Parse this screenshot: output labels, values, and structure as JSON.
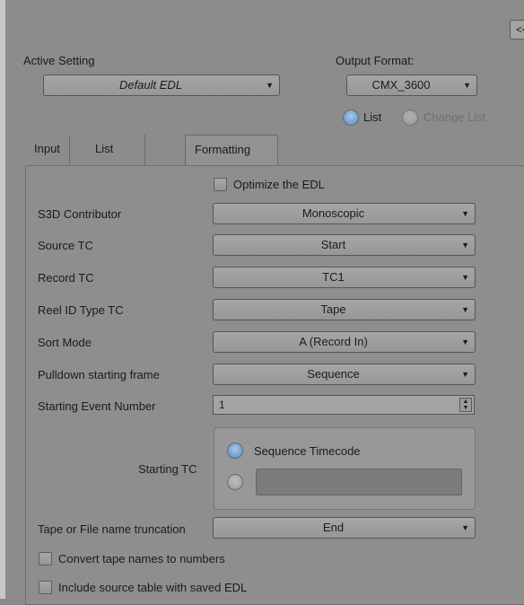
{
  "collapse_button": "<<",
  "active_setting": {
    "label": "Active Setting",
    "value": "Default EDL"
  },
  "output_format": {
    "label": "Output Format:",
    "value": "CMX_3600"
  },
  "list_mode": {
    "list_label": "List",
    "change_list_label": "Change List",
    "selected": "List"
  },
  "tabs": [
    {
      "label": "Input"
    },
    {
      "label": "List Options"
    },
    {
      "label": "Formatting",
      "active": true
    }
  ],
  "optimize": {
    "label": "Optimize the EDL",
    "checked": false
  },
  "rows": [
    {
      "label": "S3D Contributor",
      "value": "Monoscopic"
    },
    {
      "label": "Source TC",
      "value": "Start"
    },
    {
      "label": "Record TC",
      "value": "TC1"
    },
    {
      "label": "Reel ID Type TC",
      "value": "Tape"
    },
    {
      "label": "Sort Mode",
      "value": "A (Record In)"
    },
    {
      "label": "Pulldown starting frame",
      "value": "Sequence"
    }
  ],
  "starting_event": {
    "label": "Starting Event Number",
    "value": "1"
  },
  "starting_tc": {
    "label": "Starting TC",
    "option_sequence": "Sequence Timecode",
    "custom_value": "",
    "selected": "Sequence Timecode"
  },
  "truncation": {
    "label": "Tape or File name truncation",
    "value": "End"
  },
  "convert_tape": {
    "label": "Convert tape names to numbers",
    "checked": false
  },
  "include_source": {
    "label": "Include source table with saved EDL",
    "checked": false
  }
}
